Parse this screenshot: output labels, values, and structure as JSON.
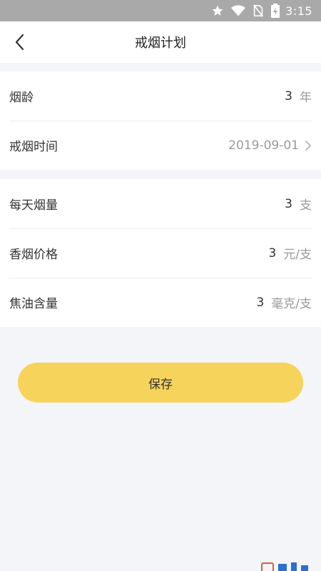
{
  "status_bar": {
    "time": "3:15",
    "icons": [
      "star-icon",
      "wifi-icon",
      "no-sim-icon",
      "battery-icon"
    ]
  },
  "header": {
    "title": "戒烟计划",
    "back_icon": "chevron-left-icon"
  },
  "section1": {
    "smoking_years": {
      "label": "烟龄",
      "value": "3",
      "unit": "年"
    },
    "quit_date": {
      "label": "戒烟时间",
      "value": "2019-09-01",
      "icon": "chevron-right-icon"
    }
  },
  "section2": {
    "daily_amount": {
      "label": "每天烟量",
      "value": "3",
      "unit": "支"
    },
    "price": {
      "label": "香烟价格",
      "value": "3",
      "unit": "元/支"
    },
    "tar": {
      "label": "焦油含量",
      "value": "3",
      "unit": "毫克/支"
    }
  },
  "save_button": {
    "label": "保存"
  },
  "colors": {
    "accent": "#f6d35a",
    "background": "#f4f5f8",
    "status_bar": "#a9a9a9"
  }
}
